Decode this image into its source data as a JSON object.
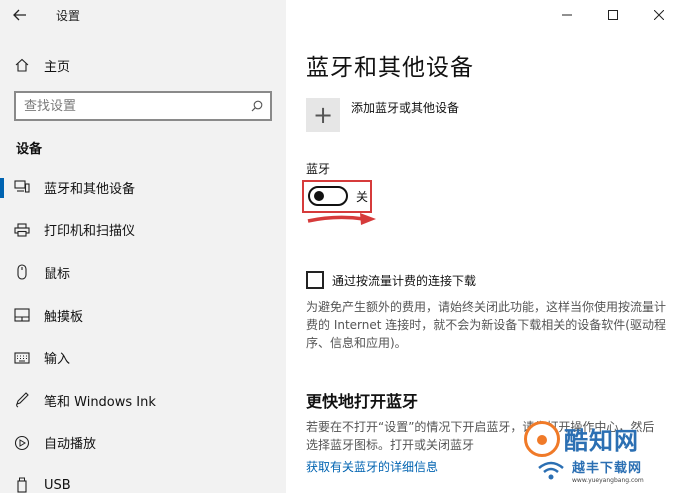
{
  "window": {
    "title": "设置",
    "controls": [
      "minimize",
      "maximize",
      "close"
    ]
  },
  "sidebar": {
    "home_label": "主页",
    "search_placeholder": "查找设置",
    "section_title": "设备",
    "items": [
      {
        "label": "蓝牙和其他设备",
        "icon": "bluetooth-devices-icon",
        "active": true
      },
      {
        "label": "打印机和扫描仪",
        "icon": "printer-icon",
        "active": false
      },
      {
        "label": "鼠标",
        "icon": "mouse-icon",
        "active": false
      },
      {
        "label": "触摸板",
        "icon": "touchpad-icon",
        "active": false
      },
      {
        "label": "输入",
        "icon": "keyboard-icon",
        "active": false
      },
      {
        "label": "笔和 Windows Ink",
        "icon": "pen-icon",
        "active": false
      },
      {
        "label": "自动播放",
        "icon": "autoplay-icon",
        "active": false
      },
      {
        "label": "USB",
        "icon": "usb-icon",
        "active": false
      }
    ]
  },
  "main": {
    "title": "蓝牙和其他设备",
    "add_device_label": "添加蓝牙或其他设备",
    "bluetooth_label": "蓝牙",
    "toggle_state_label": "关",
    "toggle_on": false,
    "metered_checkbox_label": "通过按流量计费的连接下载",
    "metered_checked": false,
    "metered_description": "为避免产生额外的费用，请始终关闭此功能，这样当你使用按流量计费的 Internet 连接时，就不会为新设备下载相关的设备软件(驱动程序、信息和应用)。",
    "faster_title": "更快地打开蓝牙",
    "faster_description": "若要在不打开“设置”的情况下开启蓝牙，请先打开操作中心，然后选择蓝牙图标。打开或关闭蓝牙",
    "link_label": "获取有关蓝牙的详细信息"
  },
  "watermark": {
    "text": "酷知网",
    "text2": "越丰下载网",
    "url": "www.yueyangbang.com"
  },
  "colors": {
    "accent": "#0063b1",
    "highlight_red": "#d63b3b",
    "sidebar_bg": "#f2f2f2"
  }
}
